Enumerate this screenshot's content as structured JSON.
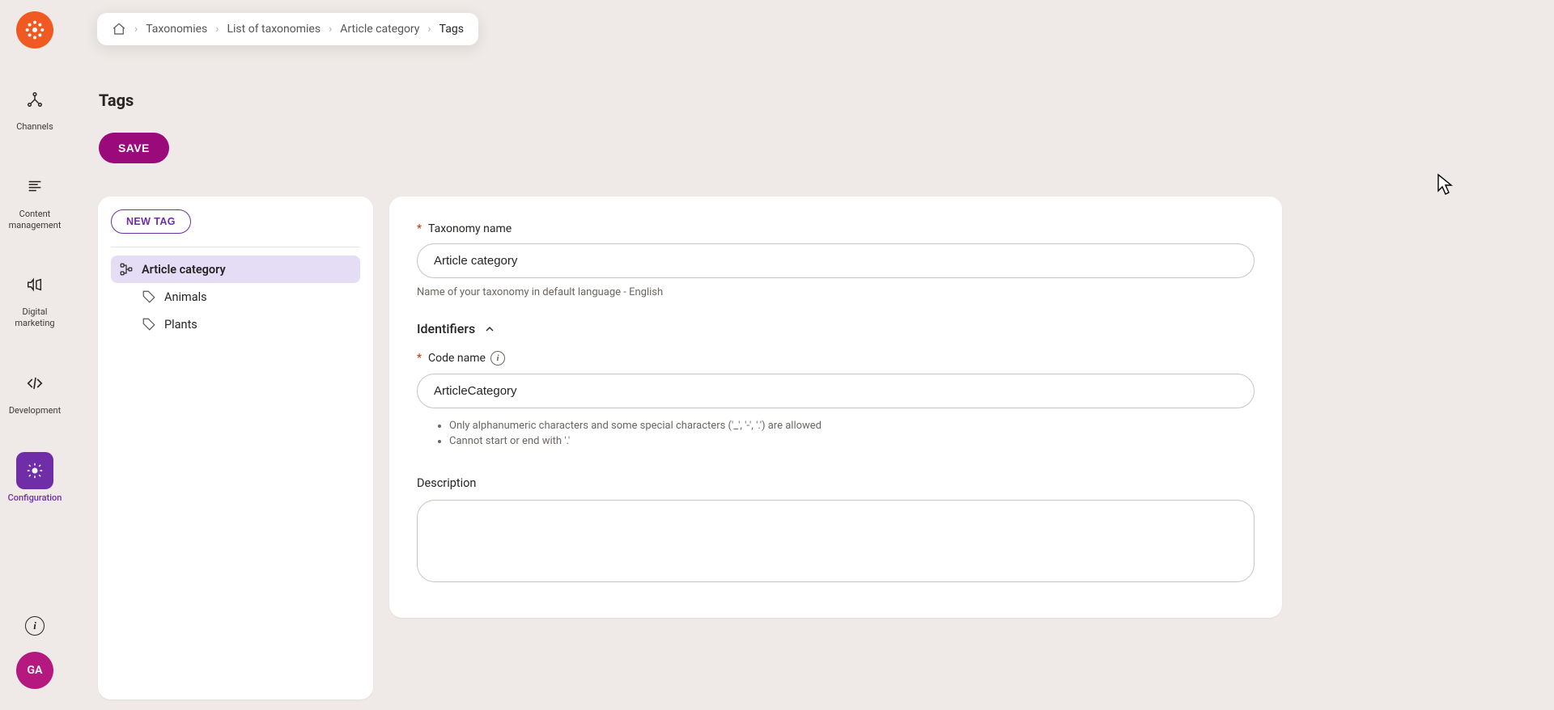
{
  "sidebar": {
    "items": [
      {
        "label": "Channels"
      },
      {
        "label": "Content\nmanagement"
      },
      {
        "label": "Digital\nmarketing"
      },
      {
        "label": "Development"
      },
      {
        "label": "Configuration"
      }
    ],
    "avatar_initials": "GA"
  },
  "breadcrumb": {
    "items": [
      "Taxonomies",
      "List of taxonomies",
      "Article category",
      "Tags"
    ]
  },
  "page_title": "Tags",
  "buttons": {
    "save": "SAVE",
    "new_tag": "NEW TAG"
  },
  "tree": {
    "root": "Article category",
    "children": [
      "Animals",
      "Plants"
    ]
  },
  "form": {
    "taxonomy_name": {
      "label": "Taxonomy name",
      "value": "Article category",
      "helper": "Name of your taxonomy in default language - English"
    },
    "identifiers_header": "Identifiers",
    "code_name": {
      "label": "Code name",
      "value": "ArticleCategory",
      "rules": [
        "Only alphanumeric characters and some special characters ('_', '-', '.') are allowed",
        "Cannot start or end with '.'"
      ]
    },
    "description_label": "Description"
  }
}
